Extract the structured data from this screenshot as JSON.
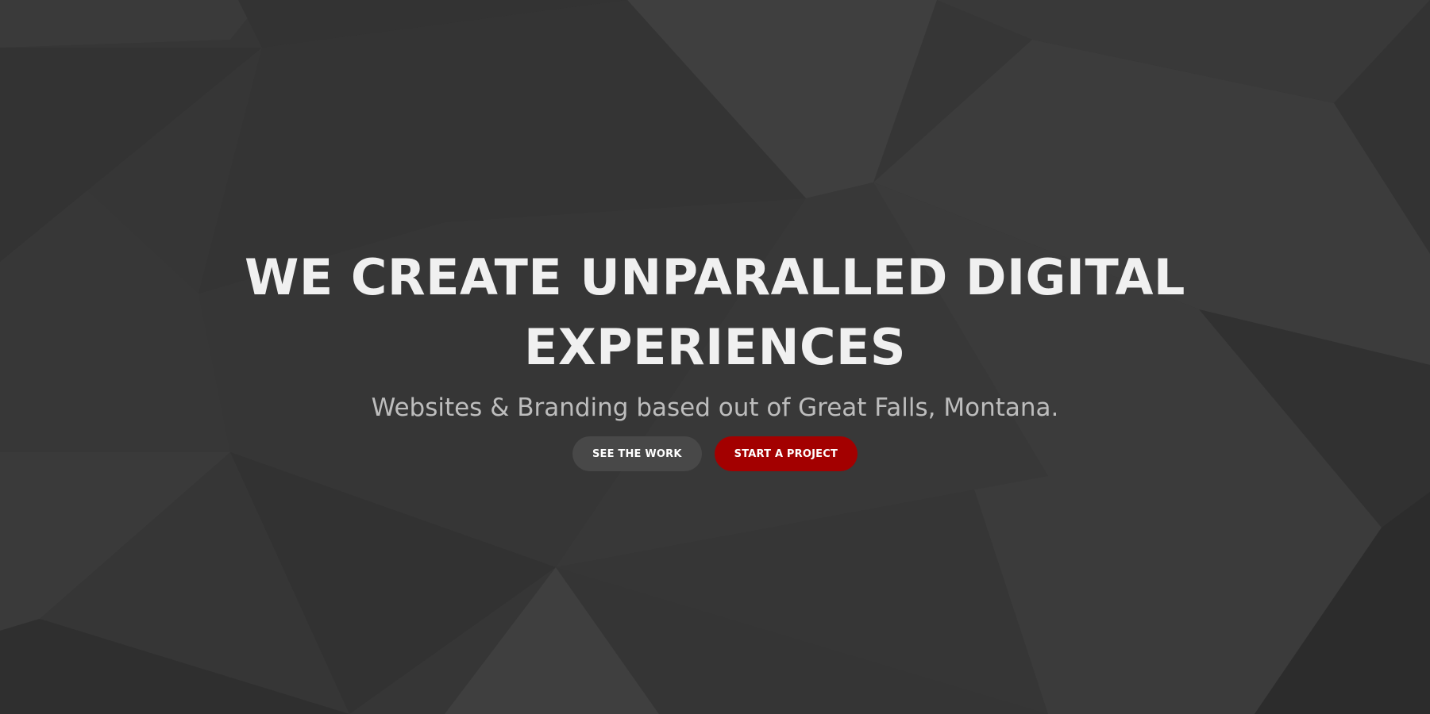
{
  "hero": {
    "headline": "WE CREATE UNPARALLED DIGITAL EXPERIENCES",
    "subheadline": "Websites & Branding based out of Great Falls, Montana.",
    "buttons": {
      "see_work_label": "SEE THE WORK",
      "start_project_label": "START A PROJECT"
    }
  },
  "colors": {
    "background": "#363636",
    "headline_text": "#f0f0f0",
    "subheadline_text": "#bdbdbd",
    "secondary_button": "#484848",
    "primary_button_accent": "#a30000"
  }
}
